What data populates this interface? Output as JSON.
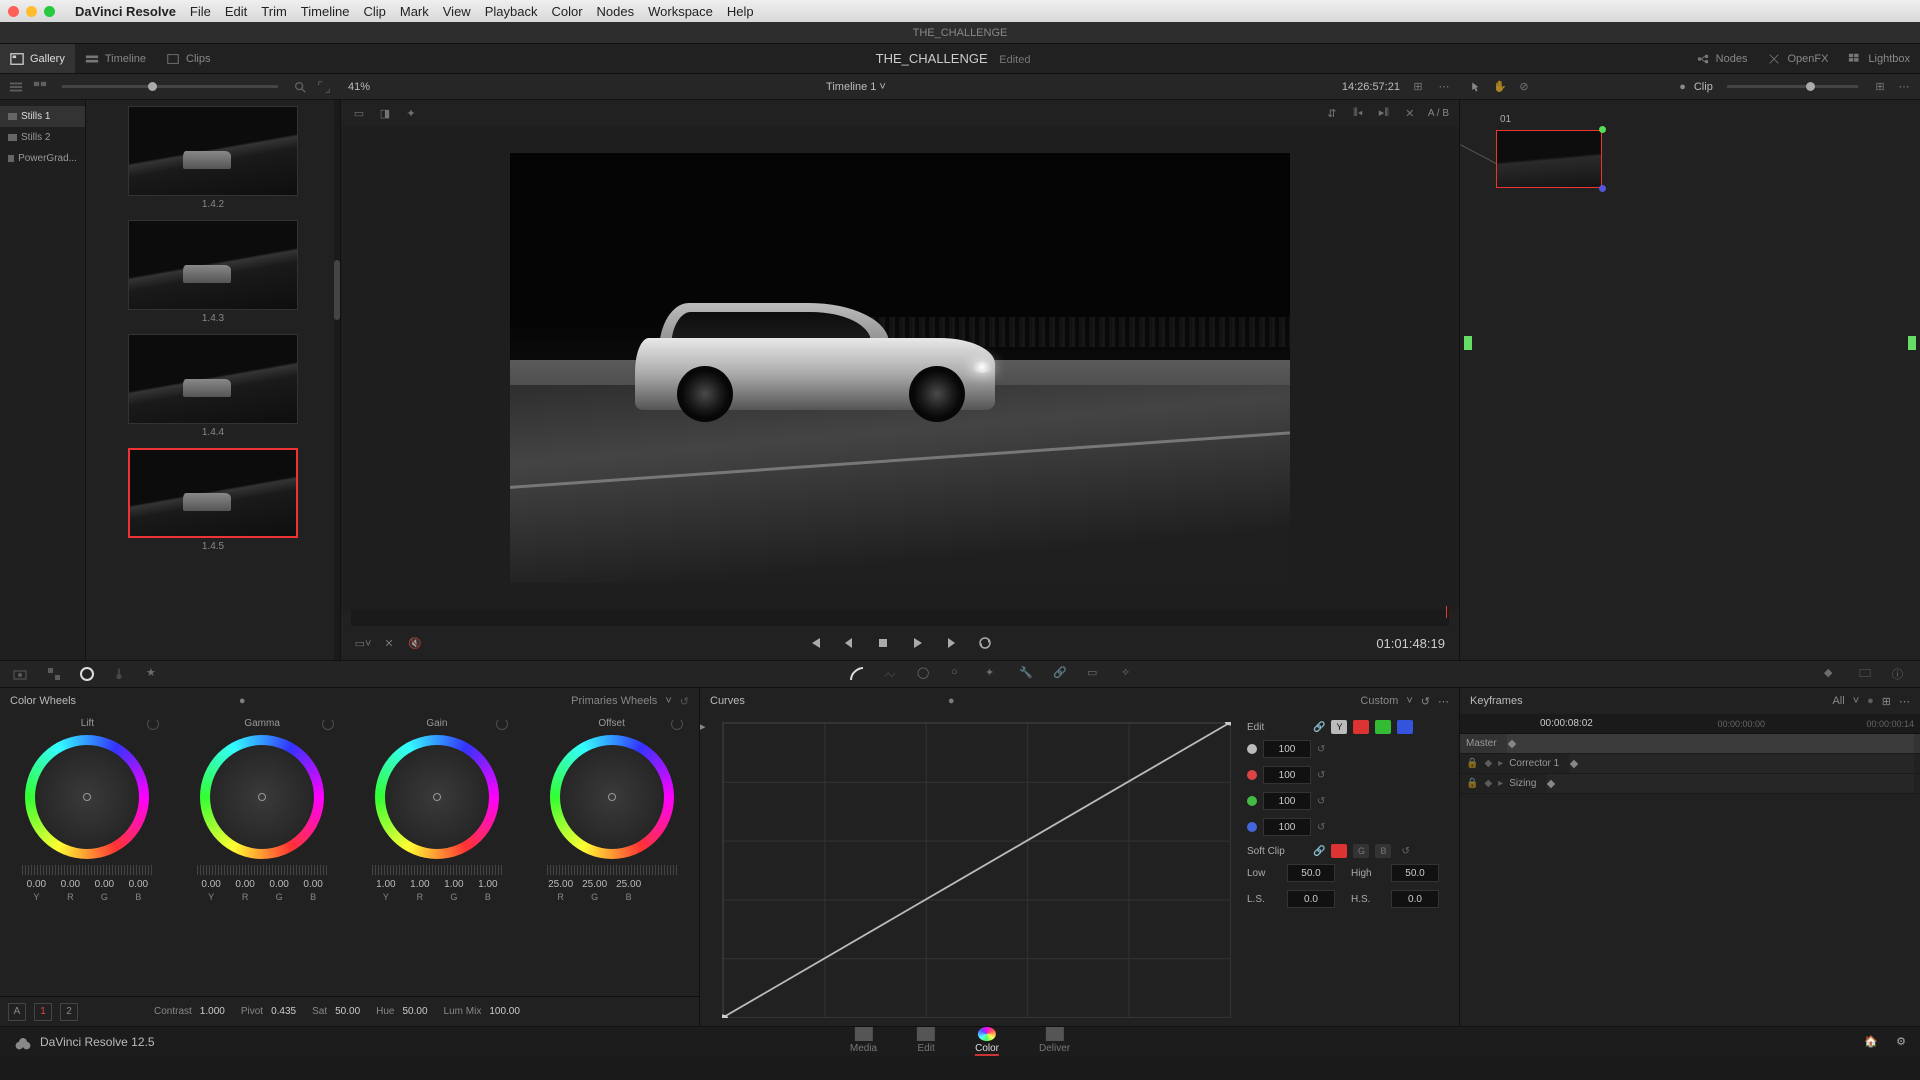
{
  "menu": {
    "app": "DaVinci Resolve",
    "items": [
      "File",
      "Edit",
      "Trim",
      "Timeline",
      "Clip",
      "Mark",
      "View",
      "Playback",
      "Color",
      "Nodes",
      "Workspace",
      "Help"
    ]
  },
  "window_title": "THE_CHALLENGE",
  "project": {
    "name": "THE_CHALLENGE",
    "status": "Edited"
  },
  "top_tabs": {
    "gallery": "Gallery",
    "timeline": "Timeline",
    "clips": "Clips",
    "nodes": "Nodes",
    "openfx": "OpenFX",
    "lightbox": "Lightbox"
  },
  "subbar": {
    "zoom": "41%",
    "timeline_name": "Timeline 1",
    "source_tc": "14:26:57:21",
    "clip_label": "Clip",
    "ab": "A / B"
  },
  "albums": [
    "Stills 1",
    "Stills 2",
    "PowerGrad..."
  ],
  "stills": [
    {
      "id": "1.4.2"
    },
    {
      "id": "1.4.3"
    },
    {
      "id": "1.4.4"
    },
    {
      "id": "1.4.5",
      "selected": true
    }
  ],
  "viewer": {
    "tc": "01:01:48:19"
  },
  "nodes": {
    "label": "01"
  },
  "tool_tabs": {
    "curves_mode": "Custom"
  },
  "wheels": {
    "title": "Color Wheels",
    "mode": "Primaries Wheels",
    "items": [
      {
        "name": "Lift",
        "vals": [
          "0.00",
          "0.00",
          "0.00",
          "0.00"
        ],
        "ch": [
          "Y",
          "R",
          "G",
          "B"
        ]
      },
      {
        "name": "Gamma",
        "vals": [
          "0.00",
          "0.00",
          "0.00",
          "0.00"
        ],
        "ch": [
          "Y",
          "R",
          "G",
          "B"
        ]
      },
      {
        "name": "Gain",
        "vals": [
          "1.00",
          "1.00",
          "1.00",
          "1.00"
        ],
        "ch": [
          "Y",
          "R",
          "G",
          "B"
        ]
      },
      {
        "name": "Offset",
        "vals": [
          "25.00",
          "25.00",
          "25.00"
        ],
        "ch": [
          "R",
          "G",
          "B"
        ]
      }
    ],
    "flags": {
      "a": "A",
      "one": "1",
      "two": "2"
    },
    "adjust": {
      "contrast_l": "Contrast",
      "contrast": "1.000",
      "pivot_l": "Pivot",
      "pivot": "0.435",
      "sat_l": "Sat",
      "sat": "50.00",
      "hue_l": "Hue",
      "hue": "50.00",
      "lummix_l": "Lum Mix",
      "lummix": "100.00"
    }
  },
  "curves": {
    "title": "Curves",
    "edit_label": "Edit",
    "channels": [
      {
        "color": "#bbb",
        "val": "100"
      },
      {
        "color": "#d44",
        "val": "100"
      },
      {
        "color": "#4b4",
        "val": "100"
      },
      {
        "color": "#46d",
        "val": "100"
      }
    ],
    "softclip_label": "Soft Clip",
    "low_l": "Low",
    "low": "50.0",
    "high_l": "High",
    "high": "50.0",
    "ls_l": "L.S.",
    "ls": "0.0",
    "hs_l": "H.S.",
    "hs": "0.0"
  },
  "keyframes": {
    "title": "Keyframes",
    "mode": "All",
    "current": "00:00:08:02",
    "start": "00:00:00:00",
    "end": "00:00:00:14",
    "lanes": [
      {
        "name": "Master",
        "master": true
      },
      {
        "name": "Corrector 1"
      },
      {
        "name": "Sizing"
      }
    ]
  },
  "pages": {
    "media": "Media",
    "edit": "Edit",
    "color": "Color",
    "deliver": "Deliver"
  },
  "footer": {
    "version": "DaVinci Resolve 12.5"
  }
}
